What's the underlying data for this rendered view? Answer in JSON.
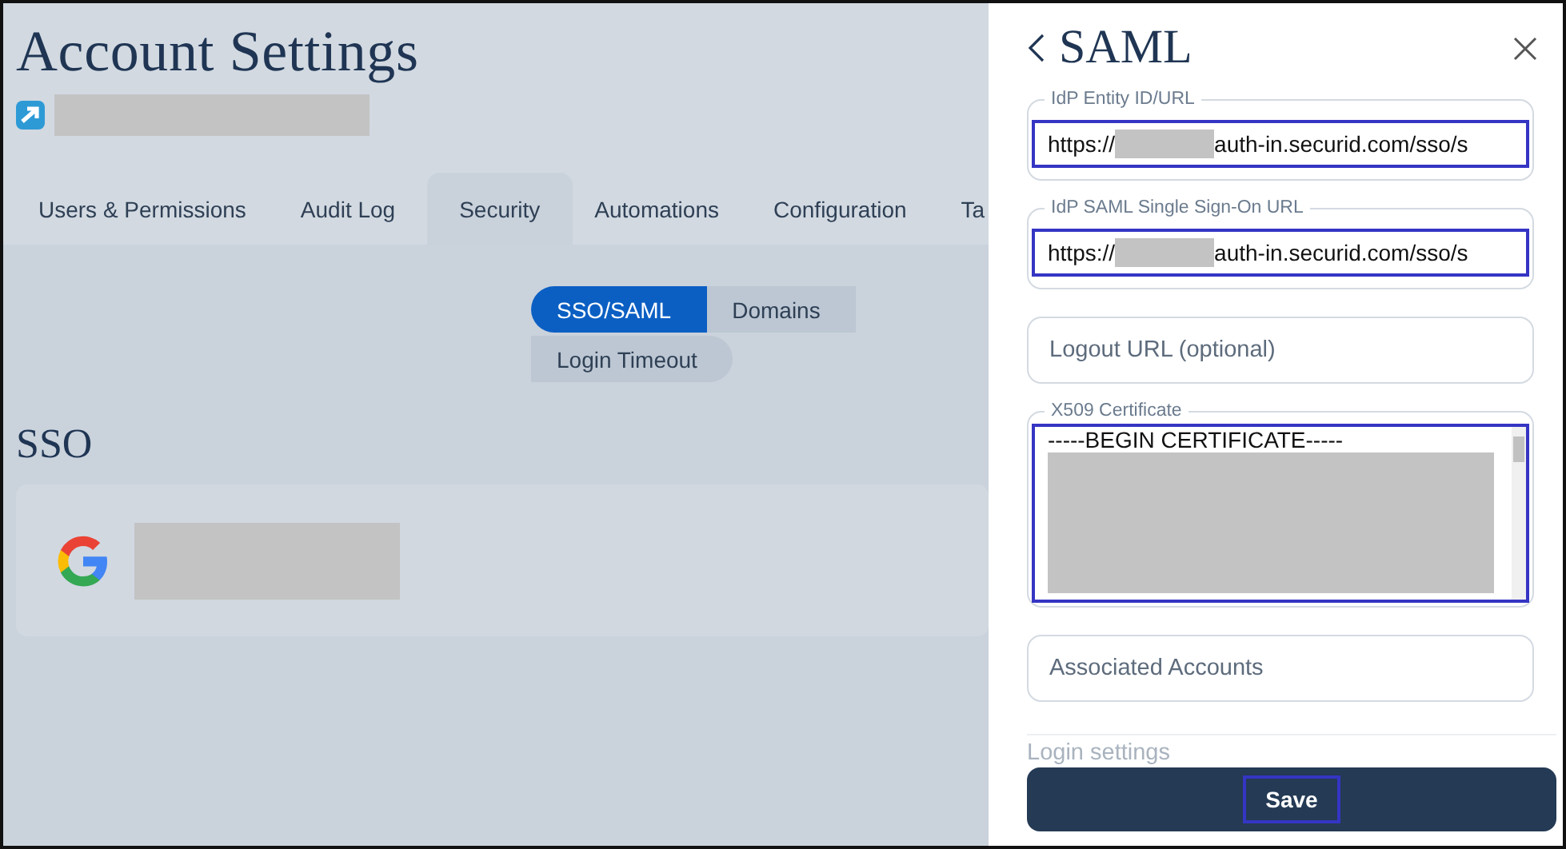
{
  "page": {
    "title": "Account Settings",
    "account": {
      "redacted": true
    }
  },
  "tabs": [
    {
      "label": "Users & Permissions",
      "selected": false
    },
    {
      "label": "Audit Log",
      "selected": false
    },
    {
      "label": "Security",
      "selected": true
    },
    {
      "label": "Automations",
      "selected": false
    },
    {
      "label": "Configuration",
      "selected": false
    },
    {
      "label": "Ta",
      "selected": false
    }
  ],
  "subtabs": [
    {
      "label": "SSO/SAML",
      "selected": true
    },
    {
      "label": "Domains",
      "selected": false
    },
    {
      "label": "Login Timeout",
      "selected": false
    }
  ],
  "section": {
    "title": "SSO",
    "providers": [
      {
        "kind": "google",
        "redacted": true
      }
    ]
  },
  "panel": {
    "title": "SAML",
    "fields": [
      {
        "kind": "text",
        "label": "IdP Entity ID/URL",
        "value_start": "https://",
        "value_end": "auth-in.securid.com/sso/s",
        "redacted": true,
        "highlighted": true
      },
      {
        "kind": "text",
        "label": "IdP SAML Single Sign-On URL",
        "value_start": "https://",
        "value_end": "auth-in.securid.com/sso/s",
        "redacted": true,
        "highlighted": true
      },
      {
        "kind": "placeholder",
        "placeholder": "Logout URL (optional)",
        "highlighted": false
      },
      {
        "kind": "textarea",
        "label": "X509 Certificate",
        "value_start": "-----BEGIN CERTIFICATE-----",
        "redacted": true,
        "highlighted": true
      },
      {
        "kind": "placeholder",
        "placeholder": "Associated Accounts",
        "highlighted": false
      }
    ],
    "section_label": "Login settings",
    "save": {
      "label": "Save",
      "highlighted": true
    }
  }
}
